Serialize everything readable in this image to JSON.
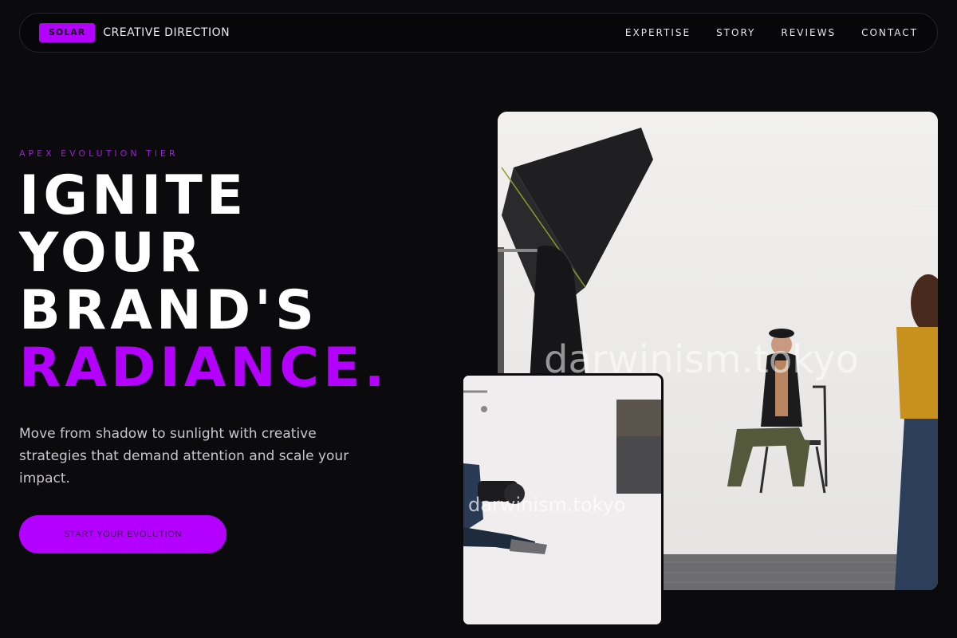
{
  "nav": {
    "brand_badge": "SOLAR",
    "brand_text": "CREATIVE DIRECTION",
    "links": [
      "EXPERTISE",
      "STORY",
      "REVIEWS",
      "CONTACT"
    ]
  },
  "hero": {
    "tier": "APEX EVOLUTION TIER",
    "headline": [
      "IGNITE",
      "YOUR",
      "BRAND'S",
      "RADIANCE."
    ],
    "subtext": "Move from shadow to sunlight with creative strategies that demand attention and scale your impact.",
    "cta_label": "START YOUR EVOLUTION"
  },
  "images": {
    "main_watermark": "darwinism.tokyo",
    "small_watermark": "darwinism.tokyo"
  },
  "colors": {
    "accent": "#b400ff",
    "background": "#0b0a0c"
  }
}
